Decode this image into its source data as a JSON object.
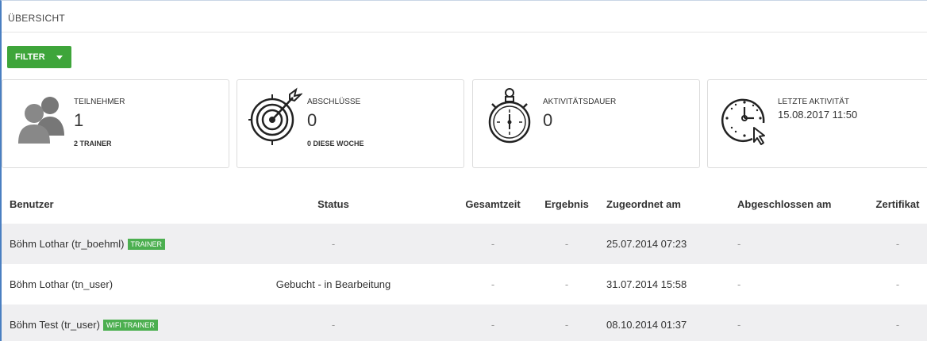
{
  "header": {
    "title": "ÜBERSICHT"
  },
  "filter": {
    "label": "FILTER"
  },
  "cards": [
    {
      "label": "TEILNEHMER",
      "value": "1",
      "sub": "2 TRAINER",
      "icon": "users-icon"
    },
    {
      "label": "ABSCHLÜSSE",
      "value": "0",
      "sub": "0 DIESE WOCHE",
      "icon": "target-icon"
    },
    {
      "label": "AKTIVITÄTSDAUER",
      "value": "0",
      "sub": "",
      "icon": "stopwatch-icon"
    },
    {
      "label": "LETZTE AKTIVITÄT",
      "value": "15.08.2017 11:50",
      "sub": "",
      "icon": "clock-cursor-icon"
    }
  ],
  "table": {
    "headers": [
      "Benutzer",
      "Status",
      "Gesamtzeit",
      "Ergebnis",
      "Zugeordnet am",
      "Abgeschlossen am",
      "Zertifikat"
    ],
    "rows": [
      {
        "user": "Böhm Lothar (tr_boehml)",
        "badge": "TRAINER",
        "status": "-",
        "gesamtzeit": "-",
        "ergebnis": "-",
        "zugeordnet": "25.07.2014 07:23",
        "abgeschlossen": "-",
        "zertifikat": "-"
      },
      {
        "user": "Böhm Lothar (tn_user)",
        "badge": "",
        "status": "Gebucht - in Bearbeitung",
        "gesamtzeit": "-",
        "ergebnis": "-",
        "zugeordnet": "31.07.2014 15:58",
        "abgeschlossen": "-",
        "zertifikat": "-"
      },
      {
        "user": "Böhm Test (tr_user)",
        "badge": "WIFI TRAINER",
        "status": "-",
        "gesamtzeit": "-",
        "ergebnis": "-",
        "zugeordnet": "08.10.2014 01:37",
        "abgeschlossen": "-",
        "zertifikat": "-"
      }
    ]
  },
  "colors": {
    "accent": "#3ea53a",
    "badge": "#4caf50",
    "row_shade": "#efeff1"
  }
}
